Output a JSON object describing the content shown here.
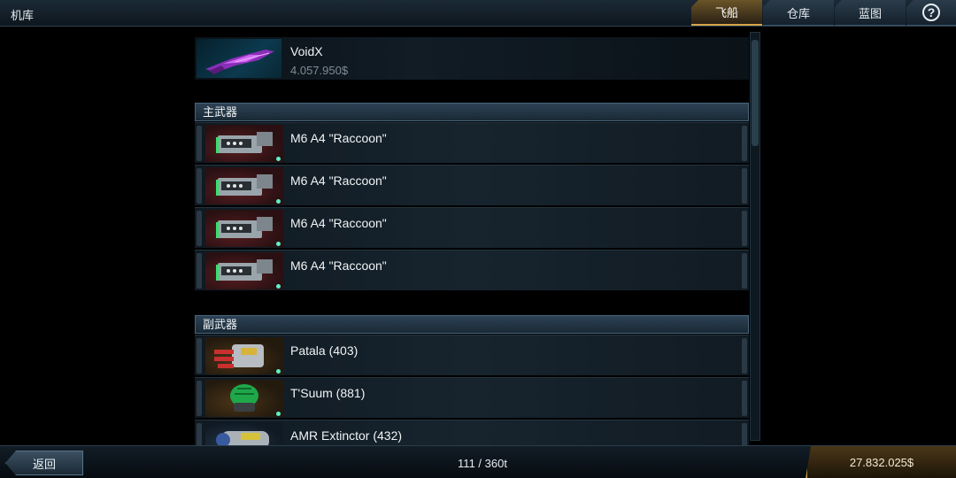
{
  "topbar": {
    "title": "机库",
    "tabs": [
      {
        "label": "飞船",
        "active": true
      },
      {
        "label": "仓库",
        "active": false
      },
      {
        "label": "蓝图",
        "active": false
      }
    ],
    "help_icon": "?"
  },
  "ship": {
    "name": "VoidX",
    "price": "4.057.950$"
  },
  "sections": {
    "primary": {
      "title": "主武器",
      "items": [
        {
          "name": "M6 A4 \"Raccoon\""
        },
        {
          "name": "M6 A4 \"Raccoon\""
        },
        {
          "name": "M6 A4 \"Raccoon\""
        },
        {
          "name": "M6 A4 \"Raccoon\""
        }
      ]
    },
    "secondary": {
      "title": "副武器",
      "items": [
        {
          "name": "Patala (403)"
        },
        {
          "name": "T'Suum (881)"
        },
        {
          "name": "AMR Extinctor (432)"
        }
      ]
    }
  },
  "bottombar": {
    "back_label": "返回",
    "cargo": "111 / 360t",
    "credits": "27.832.025$"
  },
  "colors": {
    "accent_gold": "#d6a548",
    "status_dot": "#5ff0c6"
  }
}
